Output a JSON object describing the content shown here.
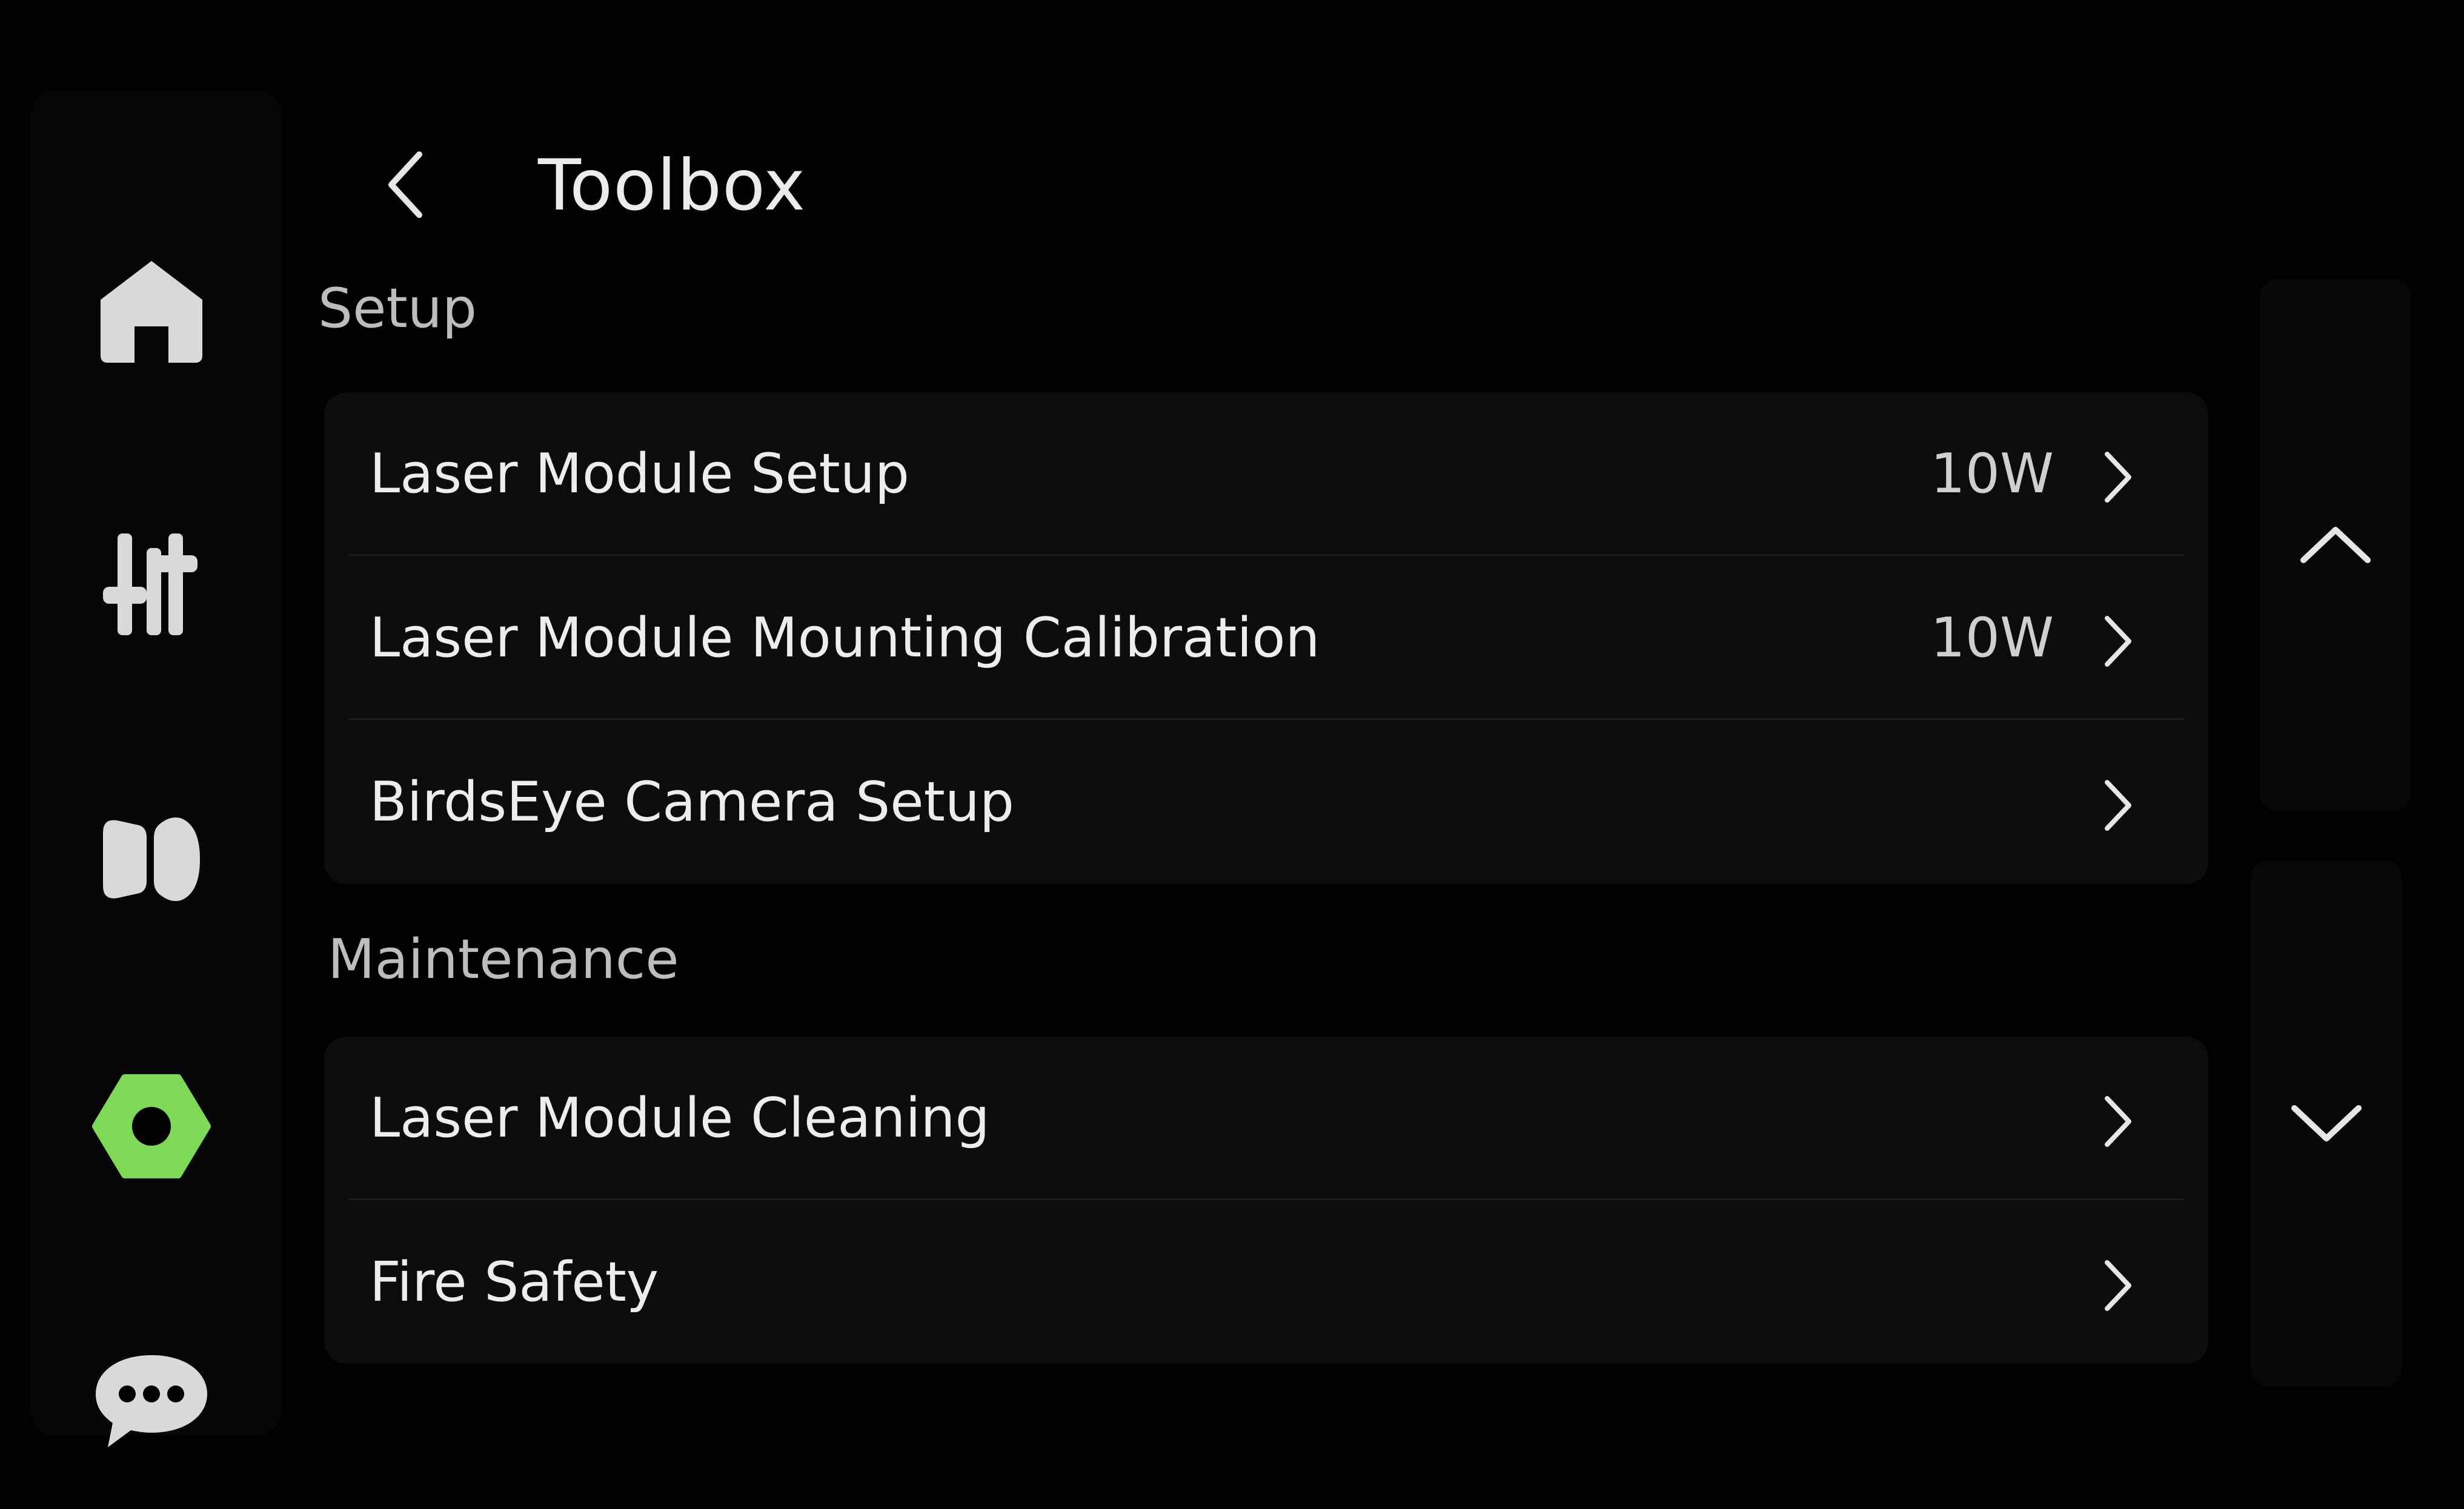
{
  "header": {
    "title": "Toolbox",
    "back_icon": "chevron-left-icon"
  },
  "nav": {
    "items": [
      {
        "id": "home",
        "icon": "home-icon",
        "active": false
      },
      {
        "id": "adjust",
        "icon": "sliders-icon",
        "active": false
      },
      {
        "id": "material",
        "icon": "material-icon",
        "active": false
      },
      {
        "id": "toolbox",
        "icon": "hex-nut-icon",
        "active": true
      },
      {
        "id": "messages",
        "icon": "chat-bubble-icon",
        "active": false
      }
    ],
    "active_color": "#7ed957",
    "inactive_color": "#d9d9d9"
  },
  "sections": [
    {
      "label": "Setup",
      "items": [
        {
          "label": "Laser Module Setup",
          "value": "10W"
        },
        {
          "label": "Laser Module Mounting Calibration",
          "value": "10W"
        },
        {
          "label": "BirdsEye Camera Setup",
          "value": ""
        }
      ]
    },
    {
      "label": "Maintenance",
      "items": [
        {
          "label": "Laser Module Cleaning",
          "value": ""
        },
        {
          "label": "Fire Safety",
          "value": ""
        }
      ]
    }
  ],
  "scroll": {
    "up_icon": "chevron-up-icon",
    "down_icon": "chevron-down-icon"
  },
  "colors": {
    "background": "#000000",
    "card": "#0c0c0c",
    "text": "#ededed",
    "section_label": "#bdbdbd",
    "accent": "#7ed957"
  }
}
